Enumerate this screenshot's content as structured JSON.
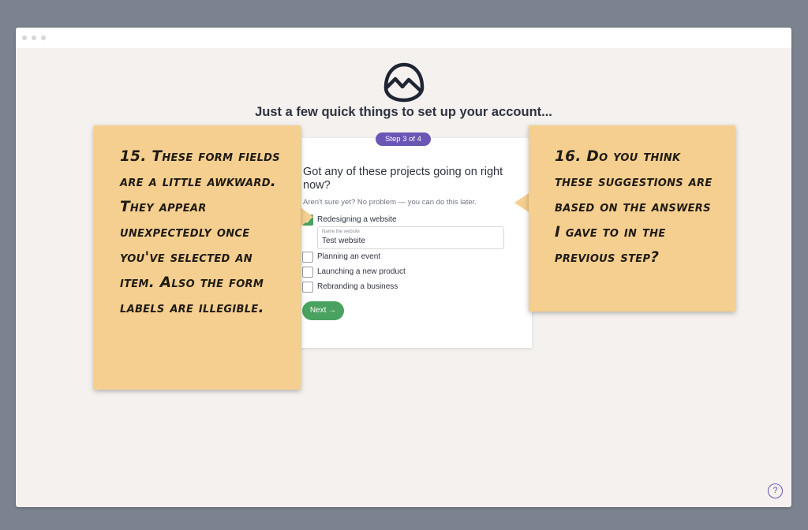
{
  "header": {
    "title": "Just a few quick things to set up your account..."
  },
  "logo": {
    "name": "basecamp-logo"
  },
  "wizard": {
    "step_label": "Step 3 of 4",
    "question": "Got any of these projects going on right now?",
    "hint": "Aren't sure yet? No problem — you can do this later.",
    "options": [
      {
        "label": "Redesigning a website",
        "checked": true
      },
      {
        "label": "Planning an event",
        "checked": false
      },
      {
        "label": "Launching a new product",
        "checked": false
      },
      {
        "label": "Rebranding a business",
        "checked": false
      }
    ],
    "website_field": {
      "label": "Name the website",
      "value": "Test website"
    },
    "next_label": "Next →"
  },
  "annotations": [
    {
      "text": "15. These form fields are a little awkward. They appear unexpectedly once you've selected an item. Also the form labels are illegible."
    },
    {
      "text": "16. Do you think these suggestions are based on the answers I gave to in the previous step?"
    }
  ],
  "help": {
    "label": "?"
  },
  "colors": {
    "accent_purple": "#6a56b4",
    "success_green": "#49a25f",
    "note_yellow": "#f5cf8f",
    "page_bg": "#f4f1ee",
    "outer_bg": "#7a838f"
  }
}
